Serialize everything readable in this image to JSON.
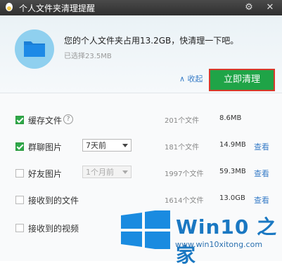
{
  "window": {
    "title": "个人文件夹清理提醒",
    "settings_icon": "gear-icon",
    "close_icon": "close-icon"
  },
  "header": {
    "message": "您的个人文件夹占用13.2GB，快清理一下吧。",
    "selected": "已选择23.5MB",
    "collapse_label": "∧ 收起",
    "clean_button": "立即清理",
    "folder_icon": "folder-icon"
  },
  "rows": [
    {
      "label": "缓存文件",
      "checked": true,
      "count": "201个文件",
      "size": "8.6MB",
      "view": ""
    },
    {
      "label": "群聊图片",
      "checked": true,
      "select": "7天前",
      "count": "181个文件",
      "size": "14.9MB",
      "view": "查看"
    },
    {
      "label": "好友图片",
      "checked": false,
      "select": "1个月前",
      "count": "1997个文件",
      "size": "59.3MB",
      "view": "查看"
    },
    {
      "label": "接收到的文件",
      "checked": false,
      "count": "1614个文件",
      "size": "13.0GB",
      "view": "查看"
    },
    {
      "label": "接收到的视频",
      "checked": false
    }
  ],
  "watermark": {
    "title": "Win10 之家",
    "url": "www.win10xitong.com"
  },
  "colors": {
    "accent_green": "#1fa447",
    "highlight_red": "#d73a2b",
    "link_blue": "#3a7ec8"
  }
}
